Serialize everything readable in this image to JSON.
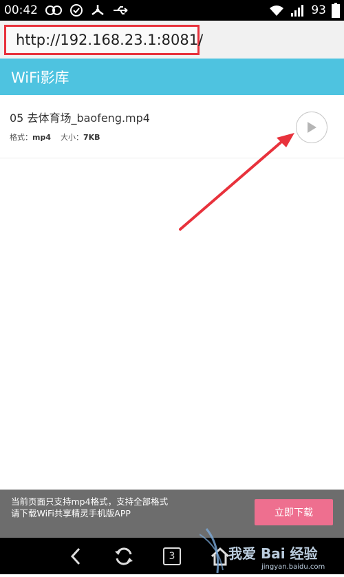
{
  "status_bar": {
    "time": "00:42",
    "battery": "93",
    "icons": [
      "infinity-icon",
      "check-circle-icon",
      "share-node-icon",
      "usb-icon",
      "wifi-icon",
      "signal-icon",
      "battery-icon"
    ]
  },
  "url_bar": {
    "url": "http://192.168.23.1:8081/"
  },
  "header": {
    "title": "WiFi影库"
  },
  "videos": [
    {
      "title": "05 去体育场_baofeng.mp4",
      "format_label": "格式：",
      "format": "mp4",
      "size_label": "大小：",
      "size": "7KB"
    }
  ],
  "promo": {
    "text": "当前页面只支持mp4格式，支持全部格式请下载WiFi共享精灵手机版APP",
    "button": "立即下载"
  },
  "nav": {
    "tab_count": "3"
  },
  "watermark": {
    "text": "我爱 Bai 经验",
    "sub": "jingyan.baidu.com"
  },
  "colors": {
    "header": "#4ec3e0",
    "highlight": "#e8323c",
    "promo_button": "#ee6f8f"
  }
}
